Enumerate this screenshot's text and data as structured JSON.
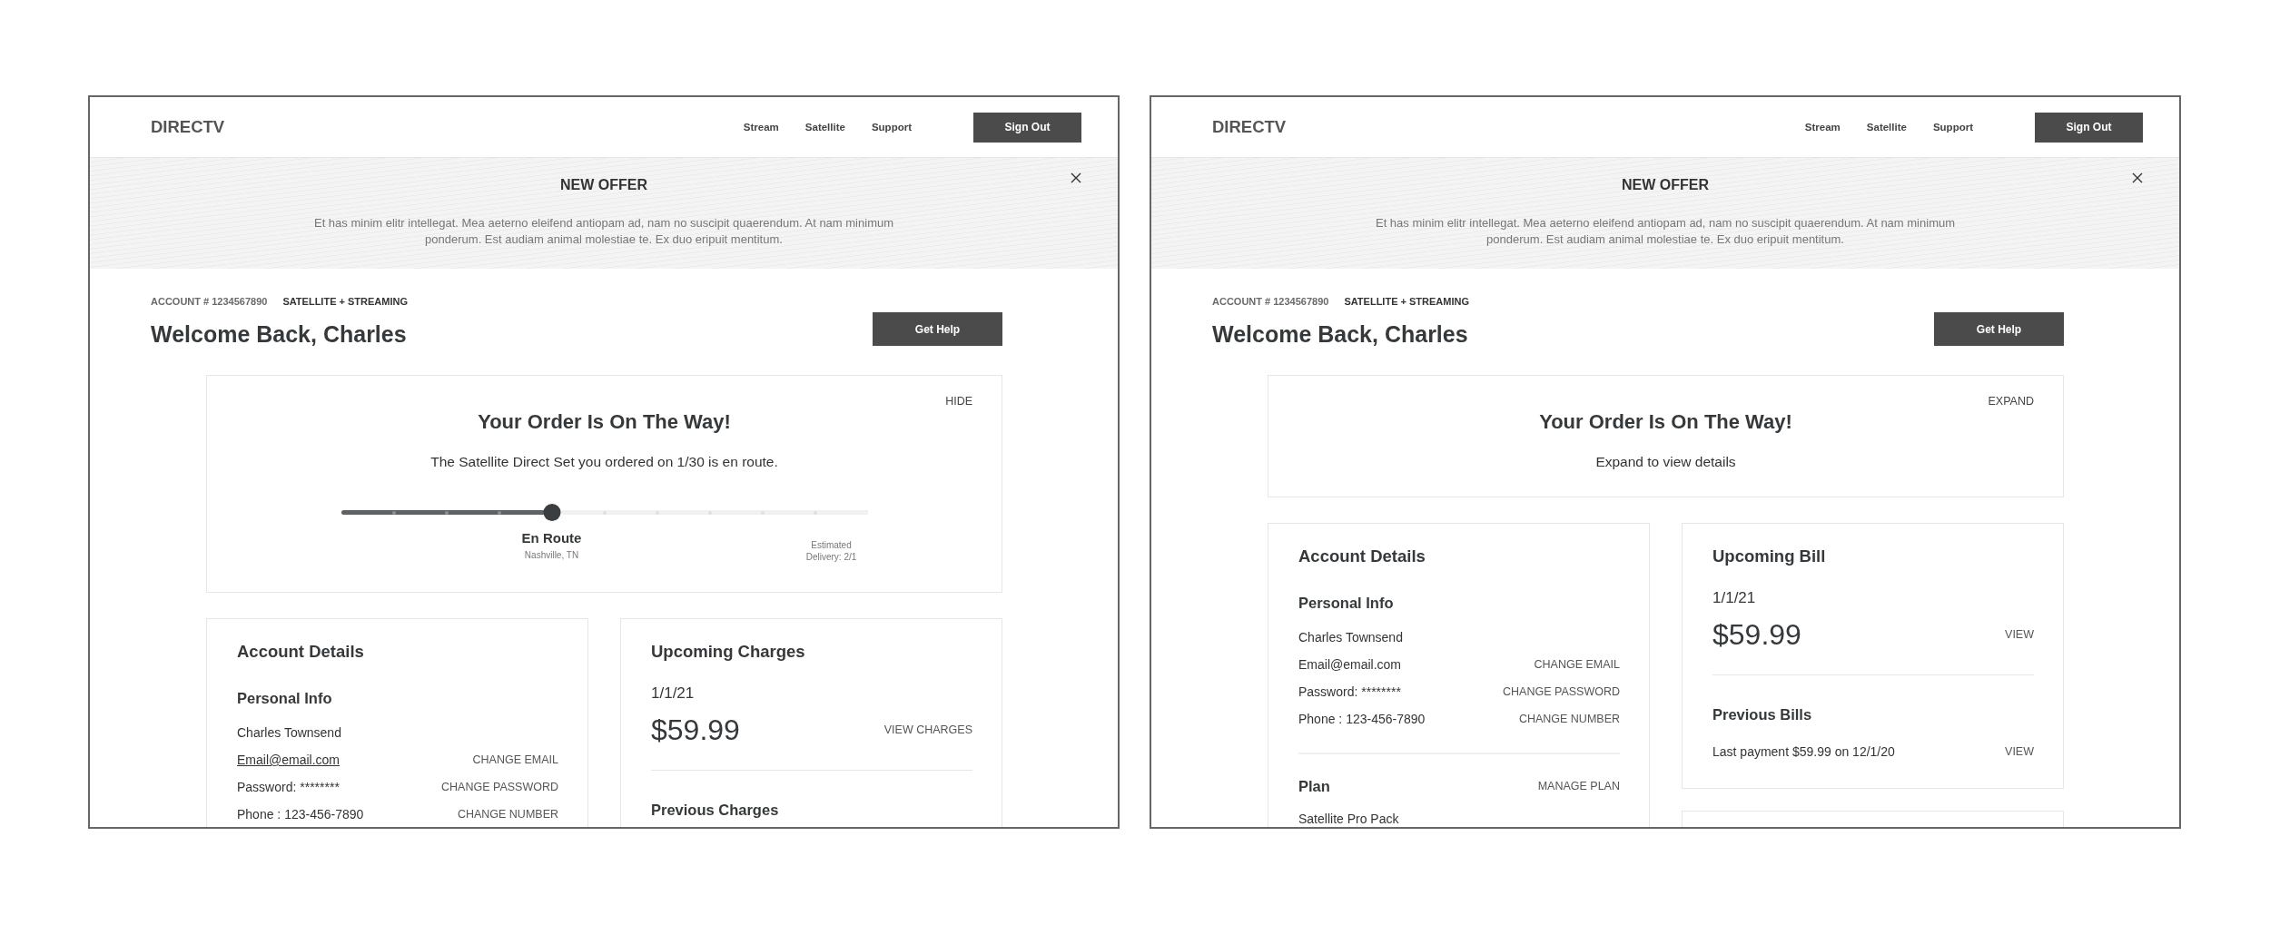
{
  "frames": [
    {
      "header": {
        "logo": "DIRECTV",
        "nav": [
          "Stream",
          "Satellite",
          "Support"
        ],
        "sign_out": "Sign Out"
      },
      "banner": {
        "title": "NEW OFFER",
        "text": "Et has minim elitr intellegat. Mea aeterno eleifend antiopam ad, nam no suscipit quaerendum. At nam minimum ponderum. Est audiam animal molestiae te. Ex duo eripuit mentitum."
      },
      "account": {
        "number": "ACCOUNT # 1234567890",
        "plan": "SATELLITE + STREAMING",
        "greeting": "Welcome Back, Charles",
        "help_button": "Get Help"
      },
      "order": {
        "expanded": true,
        "toggle": "HIDE",
        "title": "Your Order Is On The Way!",
        "subtitle": "The Satellite Direct Set you ordered on 1/30 is en route.",
        "progress": {
          "level": 0.4,
          "status": "En Route",
          "location": "Nashville, TN",
          "estimate": "Estimated Delivery: 2/1"
        }
      },
      "columns": [
        [
          {
            "kind": "account",
            "title": "Account Details",
            "sections": [
              {
                "heading": "Personal Info",
                "rows": [
                  {
                    "text": "Charles Townsend",
                    "underlined": false
                  },
                  {
                    "text": "Email@email.com",
                    "underlined": true,
                    "action": "CHANGE EMAIL"
                  },
                  {
                    "text": "Password: ********",
                    "underlined": false,
                    "action": "CHANGE PASSWORD"
                  },
                  {
                    "text": "Phone : 123-456-7890",
                    "underlined": false,
                    "action": "CHANGE NUMBER"
                  }
                ]
              }
            ]
          }
        ],
        [
          {
            "kind": "billing",
            "title": "Upcoming Charges",
            "date": "1/1/21",
            "amount": "$59.99",
            "action": "VIEW CHARGES",
            "previous": {
              "heading": "Previous Charges"
            }
          }
        ]
      ]
    },
    {
      "header": {
        "logo": "DIRECTV",
        "nav": [
          "Stream",
          "Satellite",
          "Support"
        ],
        "sign_out": "Sign Out"
      },
      "banner": {
        "title": "NEW OFFER",
        "text": "Et has minim elitr intellegat. Mea aeterno eleifend antiopam ad, nam no suscipit quaerendum. At nam minimum ponderum. Est audiam animal molestiae te. Ex duo eripuit mentitum."
      },
      "account": {
        "number": "ACCOUNT # 1234567890",
        "plan": "SATELLITE + STREAMING",
        "greeting": "Welcome Back, Charles",
        "help_button": "Get Help"
      },
      "order": {
        "expanded": false,
        "toggle": "EXPAND",
        "title": "Your Order Is On The Way!",
        "subtitle": "Expand to view details"
      },
      "columns": [
        [
          {
            "kind": "account",
            "title": "Account Details",
            "sections": [
              {
                "heading": "Personal Info",
                "rows": [
                  {
                    "text": "Charles Townsend",
                    "underlined": false
                  },
                  {
                    "text": "Email@email.com",
                    "underlined": false,
                    "action": "CHANGE EMAIL"
                  },
                  {
                    "text": "Password: ********",
                    "underlined": false,
                    "action": "CHANGE PASSWORD"
                  },
                  {
                    "text": "Phone : 123-456-7890",
                    "underlined": false,
                    "action": "CHANGE NUMBER"
                  }
                ]
              },
              {
                "heading": "Plan",
                "action": "MANAGE PLAN",
                "rows": [
                  {
                    "text": "Satellite Pro Pack",
                    "underlined": false
                  }
                ]
              }
            ]
          }
        ],
        [
          {
            "kind": "billing",
            "title": "Upcoming Bill",
            "date": "1/1/21",
            "amount": "$59.99",
            "action": "VIEW",
            "previous": {
              "heading": "Previous Bills",
              "rows": [
                {
                  "text": "Last payment $59.99 on 12/1/20",
                  "action": "VIEW"
                }
              ]
            }
          },
          {
            "kind": "blank"
          }
        ]
      ]
    }
  ]
}
